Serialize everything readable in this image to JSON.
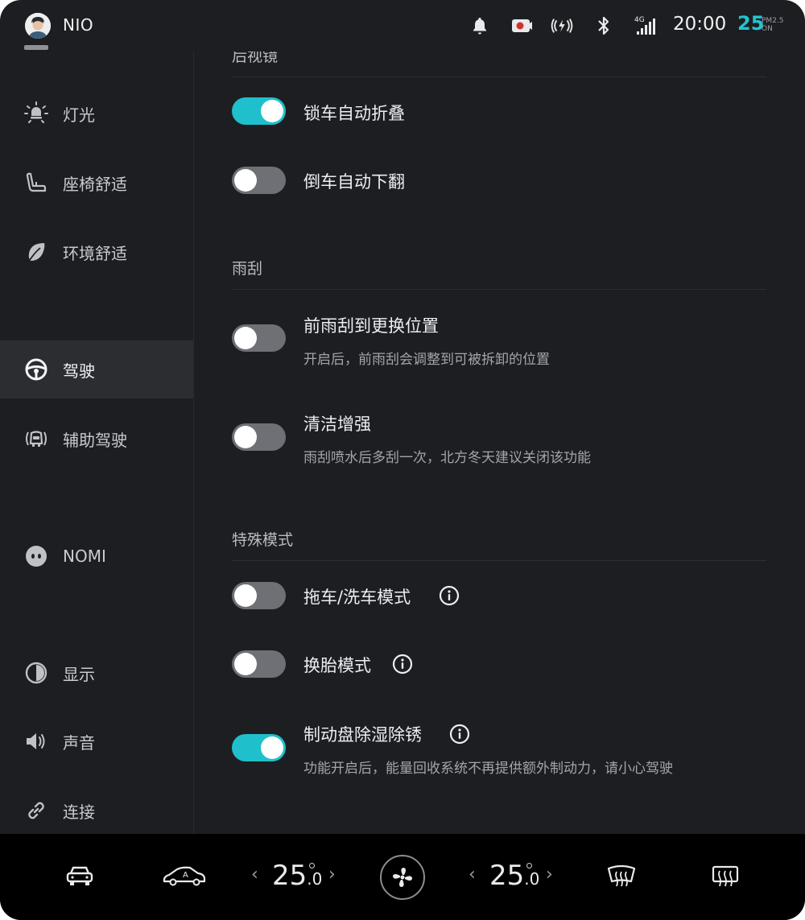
{
  "status_bar": {
    "brand": "NIO",
    "time": "20:00",
    "aqi_value": "25",
    "aqi_unit_top": "PM2.5",
    "aqi_unit_bottom": "ON",
    "network": "4G",
    "icons": [
      "bell-icon",
      "dashcam-record-icon",
      "wireless-signal-icon",
      "bluetooth-icon",
      "cellular-signal-icon"
    ],
    "accent_color": "#23c5d1"
  },
  "sidebar": {
    "items": [
      {
        "label": "灯光",
        "icon": "light-bulb-icon"
      },
      {
        "label": "座椅舒适",
        "icon": "seat-icon"
      },
      {
        "label": "环境舒适",
        "icon": "leaf-icon"
      },
      {
        "label": "驾驶",
        "icon": "steering-wheel-icon",
        "active": true
      },
      {
        "label": "辅助驾驶",
        "icon": "driver-assist-icon"
      },
      {
        "label": "NOMI",
        "icon": "nomi-face-icon"
      },
      {
        "label": "显示",
        "icon": "display-contrast-icon"
      },
      {
        "label": "声音",
        "icon": "speaker-icon"
      },
      {
        "label": "连接",
        "icon": "link-icon"
      }
    ]
  },
  "content": {
    "mirror_section": {
      "title": "后视镜",
      "options": [
        {
          "label": "锁车自动折叠",
          "on": true
        },
        {
          "label": "倒车自动下翻",
          "on": false
        }
      ]
    },
    "wiper_section": {
      "title": "雨刮",
      "options": [
        {
          "label": "前雨刮到更换位置",
          "description": "开启后，前雨刮会调整到可被拆卸的位置",
          "on": false
        },
        {
          "label": "清洁增强",
          "description": "雨刮喷水后多刮一次，北方冬天建议关闭该功能",
          "on": false
        }
      ]
    },
    "special_section": {
      "title": "特殊模式",
      "options": [
        {
          "label": "拖车/洗车模式",
          "has_info": true,
          "on": false
        },
        {
          "label": "换胎模式",
          "has_info": true,
          "on": false
        },
        {
          "label": "制动盘除湿除锈",
          "description": "功能开启后，能量回收系统不再提供额外制动力，请小心驾驶",
          "has_info": true,
          "on": true
        }
      ]
    }
  },
  "dock": {
    "left_temp_int": "25",
    "left_temp_dec": ".0",
    "right_temp_int": "25",
    "right_temp_dec": ".0",
    "chevron_left": "‹",
    "chevron_right": "›",
    "auto_label": "A",
    "icons": [
      "car-icon",
      "auto-climate-car-icon",
      "fan-icon",
      "front-defrost-icon",
      "rear-defrost-icon"
    ]
  }
}
